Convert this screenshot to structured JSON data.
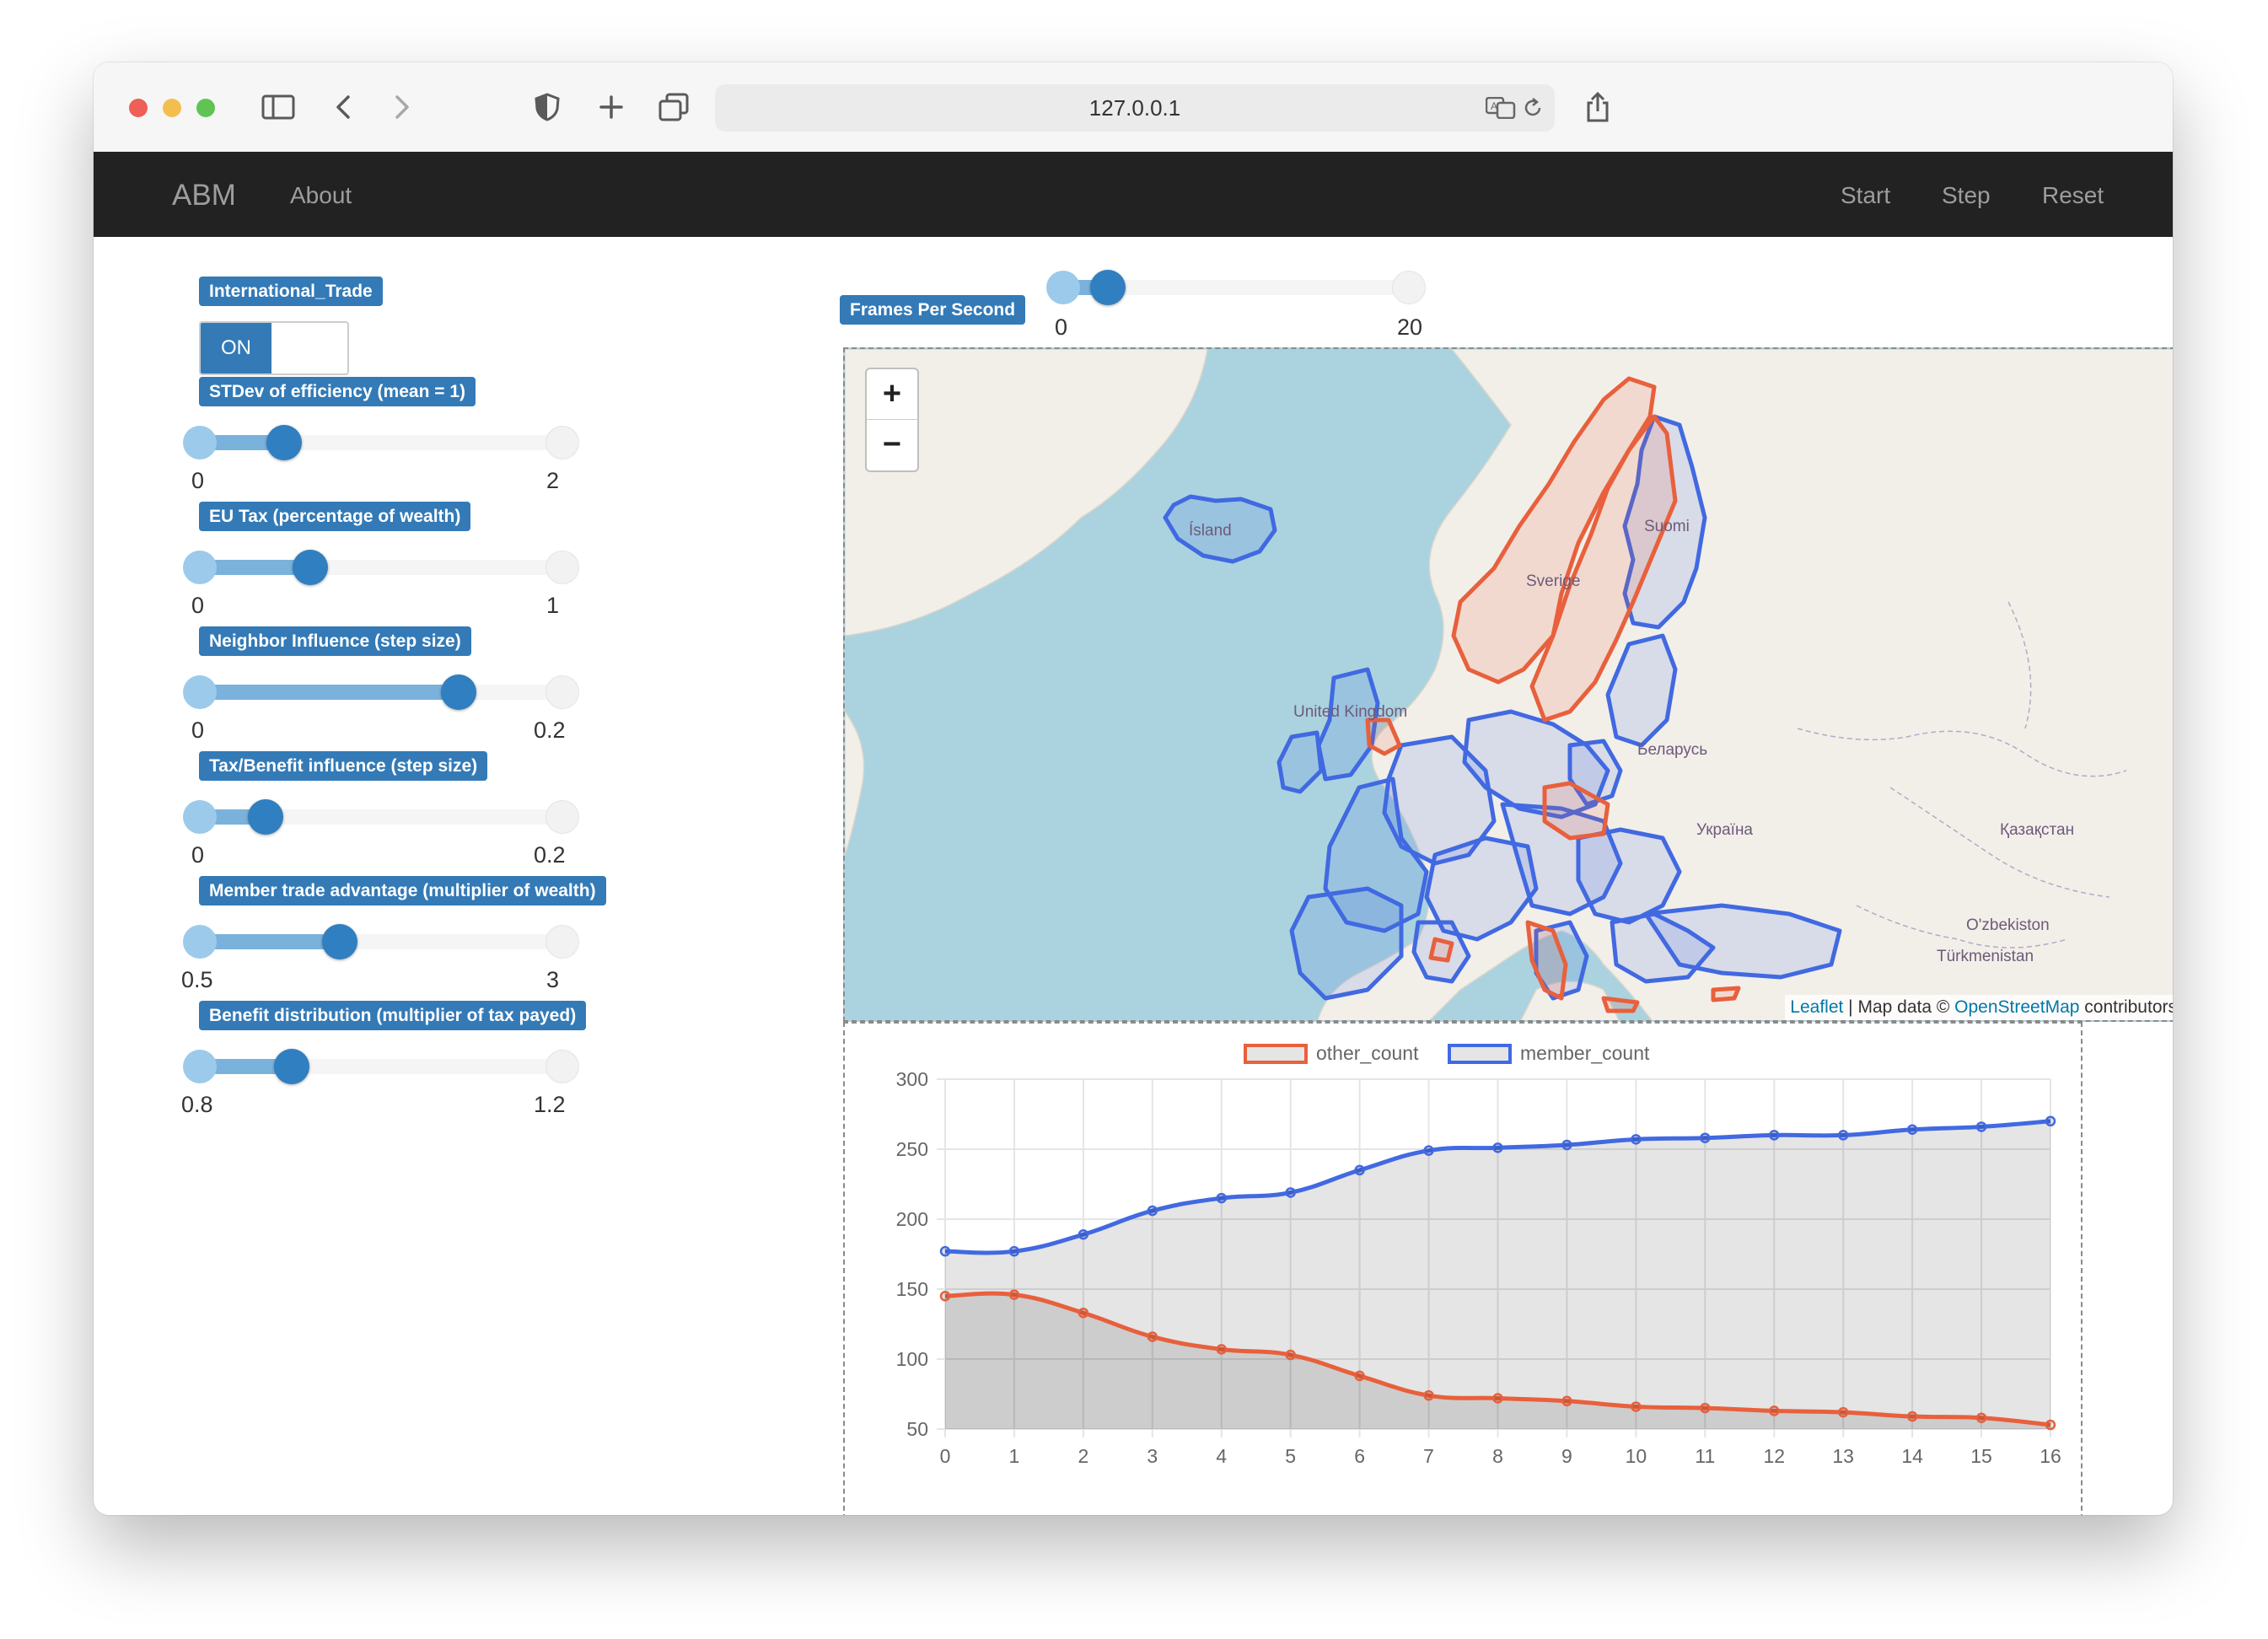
{
  "browser": {
    "url": "127.0.0.1"
  },
  "navbar": {
    "brand": "ABM",
    "about": "About",
    "start": "Start",
    "step": "Step",
    "reset": "Reset"
  },
  "params": {
    "international_trade": {
      "label": "International_Trade",
      "toggle": "ON"
    },
    "stdev": {
      "label": "STDev of efficiency (mean = 1)",
      "min": "0",
      "max": "2",
      "value": 0.25
    },
    "eu_tax": {
      "label": "EU Tax (percentage of wealth)",
      "min": "0",
      "max": "1",
      "value": 0.32
    },
    "neighbor": {
      "label": "Neighbor Influence (step size)",
      "min": "0",
      "max": "0.2",
      "value": 0.72
    },
    "tax_benefit": {
      "label": "Tax/Benefit influence (step size)",
      "min": "0",
      "max": "0.2",
      "value": 0.2
    },
    "trade_advantage": {
      "label": "Member trade advantage (multiplier of wealth)",
      "min": "0.5",
      "max": "3",
      "value": 0.4
    },
    "benefit_dist": {
      "label": "Benefit distribution (multiplier of tax payed)",
      "min": "0.8",
      "max": "1.2",
      "value": 0.27
    }
  },
  "fps": {
    "label": "Frames Per Second",
    "min": "0",
    "max": "20",
    "value": 0.15
  },
  "map": {
    "zoom_in": "+",
    "zoom_out": "−",
    "attribution_leaflet": "Leaflet",
    "attribution_mid": " | Map data © ",
    "attribution_osm": "OpenStreetMap",
    "attribution_end": " contributors",
    "labels": {
      "island": "Ísland",
      "sverige": "Sverige",
      "suomi": "Suomi",
      "uk": "United Kingdom",
      "belarus": "Беларусь",
      "ukraina": "Україна",
      "kazakhstan": "Қазақстан",
      "uzbekistan": "O'zbekiston",
      "turkmenistan": "Türkmenistan"
    },
    "colors": {
      "member": "#4169e1",
      "other": "#e8603c",
      "water": "#aad3df",
      "land": "#f2efe9"
    }
  },
  "chart_data": {
    "type": "line",
    "x": [
      0,
      1,
      2,
      3,
      4,
      5,
      6,
      7,
      8,
      9,
      10,
      11,
      12,
      13,
      14,
      15,
      16
    ],
    "series": [
      {
        "name": "other_count",
        "color": "#e8603c",
        "values": [
          145,
          146,
          133,
          116,
          107,
          103,
          88,
          74,
          72,
          70,
          66,
          65,
          63,
          62,
          59,
          58,
          53
        ]
      },
      {
        "name": "member_count",
        "color": "#4169e1",
        "values": [
          177,
          177,
          189,
          206,
          215,
          219,
          235,
          249,
          251,
          253,
          257,
          258,
          260,
          260,
          264,
          266,
          270
        ]
      }
    ],
    "ylim": [
      50,
      300
    ],
    "yticks": [
      "50",
      "100",
      "150",
      "200",
      "250",
      "300"
    ],
    "xticks": [
      "0",
      "1",
      "2",
      "3",
      "4",
      "5",
      "6",
      "7",
      "8",
      "9",
      "10",
      "11",
      "12",
      "13",
      "14",
      "15",
      "16"
    ],
    "grid": true,
    "legend": "top"
  }
}
